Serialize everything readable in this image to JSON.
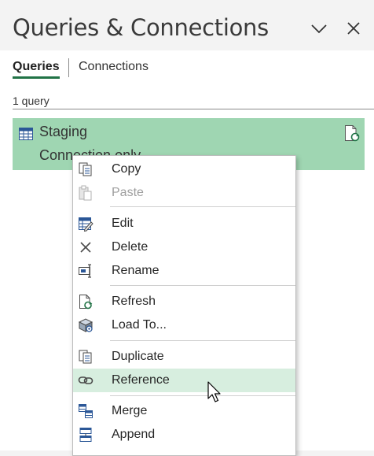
{
  "pane": {
    "title": "Queries & Connections"
  },
  "tabs": [
    {
      "label": "Queries"
    },
    {
      "label": "Connections"
    }
  ],
  "query_count": "1 query",
  "query": {
    "name": "Staging",
    "status": "Connection only."
  },
  "context_menu": {
    "items": [
      {
        "label": "Copy",
        "icon": "copy-icon",
        "enabled": true
      },
      {
        "label": "Paste",
        "icon": "paste-icon",
        "enabled": false
      },
      {
        "label": "Edit",
        "icon": "edit-icon",
        "enabled": true
      },
      {
        "label": "Delete",
        "icon": "delete-icon",
        "enabled": true
      },
      {
        "label": "Rename",
        "icon": "rename-icon",
        "enabled": true
      },
      {
        "label": "Refresh",
        "icon": "refresh-icon",
        "enabled": true
      },
      {
        "label": "Load To...",
        "icon": "load-to-icon",
        "enabled": true
      },
      {
        "label": "Duplicate",
        "icon": "duplicate-icon",
        "enabled": true
      },
      {
        "label": "Reference",
        "icon": "reference-icon",
        "enabled": true,
        "highlighted": true
      },
      {
        "label": "Merge",
        "icon": "merge-icon",
        "enabled": true
      },
      {
        "label": "Append",
        "icon": "append-icon",
        "enabled": true
      }
    ]
  },
  "colors": {
    "accent": "#217346",
    "selected_row": "#9fd6b2",
    "menu_hover": "#d7eedf"
  }
}
